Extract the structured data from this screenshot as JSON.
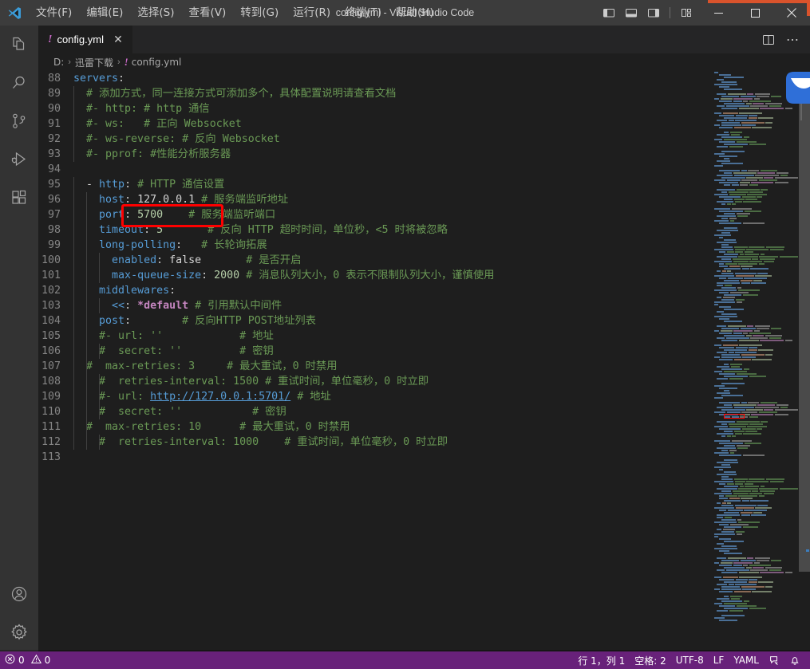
{
  "window": {
    "title": "config.yml - Visual Studio Code",
    "logo_icon": "vscode-logo",
    "minimize_label": "—",
    "maximize_label": "☐",
    "close_label": "✕"
  },
  "menubar": {
    "items": [
      {
        "label": "文件(F)",
        "name": "menu-file"
      },
      {
        "label": "编辑(E)",
        "name": "menu-edit"
      },
      {
        "label": "选择(S)",
        "name": "menu-selection"
      },
      {
        "label": "查看(V)",
        "name": "menu-view"
      },
      {
        "label": "转到(G)",
        "name": "menu-go"
      },
      {
        "label": "运行(R)",
        "name": "menu-run"
      },
      {
        "label": "终端(T)",
        "name": "menu-terminal"
      },
      {
        "label": "帮助(H)",
        "name": "menu-help"
      }
    ]
  },
  "layout_controls": [
    {
      "name": "toggle-primary-sidebar-icon"
    },
    {
      "name": "toggle-panel-icon"
    },
    {
      "name": "toggle-secondary-sidebar-icon"
    },
    {
      "name": "customize-layout-icon"
    }
  ],
  "activitybar": {
    "top": [
      {
        "name": "activity-explorer",
        "icon": "files-icon",
        "active": false
      },
      {
        "name": "activity-search",
        "icon": "search-icon",
        "active": false
      },
      {
        "name": "activity-source-control",
        "icon": "source-control-icon",
        "active": false
      },
      {
        "name": "activity-run-debug",
        "icon": "run-and-debug-icon",
        "active": false
      },
      {
        "name": "activity-extensions",
        "icon": "extensions-icon",
        "active": false
      }
    ],
    "bottom": [
      {
        "name": "activity-accounts",
        "icon": "account-icon"
      },
      {
        "name": "activity-settings",
        "icon": "gear-icon"
      }
    ]
  },
  "tabs": [
    {
      "label": "config.yml",
      "icon": "yaml-file-icon",
      "icon_glyph": "!",
      "close_glyph": "✕",
      "active": true
    }
  ],
  "editor_actions": [
    {
      "name": "split-editor-right-icon"
    },
    {
      "name": "more-actions-icon",
      "glyph": "⋯"
    }
  ],
  "breadcrumb": {
    "items": [
      {
        "label": "D:",
        "name": "breadcrumb-drive"
      },
      {
        "label": "迅雷下载",
        "name": "breadcrumb-folder"
      },
      {
        "label": "config.yml",
        "name": "breadcrumb-file",
        "icon_glyph": "!"
      }
    ],
    "separator": "›"
  },
  "annotation": {
    "name": "red-highlight-box",
    "color": "#ff0000",
    "targets": "port: 5700"
  },
  "editor": {
    "first_line": 88,
    "lines": [
      {
        "n": 88,
        "indent": 0,
        "guides": 0,
        "tokens": [
          {
            "t": "key",
            "v": "servers"
          },
          {
            "t": "punc",
            "v": ":"
          }
        ]
      },
      {
        "n": 89,
        "indent": 2,
        "guides": 1,
        "tokens": [
          {
            "t": "cmt",
            "v": "# 添加方式，同一连接方式可添加多个，具体配置说明请查看文档"
          }
        ]
      },
      {
        "n": 90,
        "indent": 2,
        "guides": 1,
        "tokens": [
          {
            "t": "cmt",
            "v": "#- http: # http 通信"
          }
        ]
      },
      {
        "n": 91,
        "indent": 2,
        "guides": 1,
        "tokens": [
          {
            "t": "cmt",
            "v": "#- ws:   # 正向 Websocket"
          }
        ]
      },
      {
        "n": 92,
        "indent": 2,
        "guides": 1,
        "tokens": [
          {
            "t": "cmt",
            "v": "#- ws-reverse: # 反向 Websocket"
          }
        ]
      },
      {
        "n": 93,
        "indent": 2,
        "guides": 1,
        "tokens": [
          {
            "t": "cmt",
            "v": "#- pprof: #性能分析服务器"
          }
        ]
      },
      {
        "n": 94,
        "indent": 0,
        "guides": 0,
        "tokens": []
      },
      {
        "n": 95,
        "indent": 2,
        "guides": 1,
        "tokens": [
          {
            "t": "plain",
            "v": "- "
          },
          {
            "t": "key",
            "v": "http"
          },
          {
            "t": "punc",
            "v": ": "
          },
          {
            "t": "cmt",
            "v": "# HTTP 通信设置"
          }
        ]
      },
      {
        "n": 96,
        "indent": 4,
        "guides": 2,
        "tokens": [
          {
            "t": "key",
            "v": "host"
          },
          {
            "t": "punc",
            "v": ": "
          },
          {
            "t": "plain",
            "v": "127.0.0.1 "
          },
          {
            "t": "cmt",
            "v": "# 服务端监听地址"
          }
        ]
      },
      {
        "n": 97,
        "indent": 4,
        "guides": 2,
        "tokens": [
          {
            "t": "key",
            "v": "port"
          },
          {
            "t": "punc",
            "v": ": "
          },
          {
            "t": "num",
            "v": "5700"
          },
          {
            "t": "plain",
            "v": "    "
          },
          {
            "t": "cmt",
            "v": "# 服务端监听端口"
          }
        ]
      },
      {
        "n": 98,
        "indent": 4,
        "guides": 2,
        "tokens": [
          {
            "t": "key",
            "v": "timeout"
          },
          {
            "t": "punc",
            "v": ": "
          },
          {
            "t": "num",
            "v": "5"
          },
          {
            "t": "plain",
            "v": "       "
          },
          {
            "t": "cmt",
            "v": "# 反向 HTTP 超时时间，单位秒，<5 时将被忽略"
          }
        ]
      },
      {
        "n": 99,
        "indent": 4,
        "guides": 2,
        "tokens": [
          {
            "t": "key",
            "v": "long-polling"
          },
          {
            "t": "punc",
            "v": ":"
          },
          {
            "t": "plain",
            "v": "   "
          },
          {
            "t": "cmt",
            "v": "# 长轮询拓展"
          }
        ]
      },
      {
        "n": 100,
        "indent": 6,
        "guides": 3,
        "tokens": [
          {
            "t": "key",
            "v": "enabled"
          },
          {
            "t": "punc",
            "v": ": "
          },
          {
            "t": "plain",
            "v": "false"
          },
          {
            "t": "plain",
            "v": "       "
          },
          {
            "t": "cmt",
            "v": "# 是否开启"
          }
        ]
      },
      {
        "n": 101,
        "indent": 6,
        "guides": 3,
        "tokens": [
          {
            "t": "key",
            "v": "max-queue-size"
          },
          {
            "t": "punc",
            "v": ": "
          },
          {
            "t": "num",
            "v": "2000"
          },
          {
            "t": "plain",
            "v": " "
          },
          {
            "t": "cmt",
            "v": "# 消息队列大小，0 表示不限制队列大小，谨慎使用"
          }
        ]
      },
      {
        "n": 102,
        "indent": 4,
        "guides": 2,
        "tokens": [
          {
            "t": "key",
            "v": "middlewares"
          },
          {
            "t": "punc",
            "v": ":"
          }
        ]
      },
      {
        "n": 103,
        "indent": 6,
        "guides": 3,
        "tokens": [
          {
            "t": "key",
            "v": "<<"
          },
          {
            "t": "punc",
            "v": ": "
          },
          {
            "t": "anchor",
            "v": "*default"
          },
          {
            "t": "plain",
            "v": " "
          },
          {
            "t": "cmt",
            "v": "# 引用默认中间件"
          }
        ]
      },
      {
        "n": 104,
        "indent": 4,
        "guides": 2,
        "tokens": [
          {
            "t": "key",
            "v": "post"
          },
          {
            "t": "punc",
            "v": ":"
          },
          {
            "t": "plain",
            "v": "        "
          },
          {
            "t": "cmt",
            "v": "# 反向HTTP POST地址列表"
          }
        ]
      },
      {
        "n": 105,
        "indent": 4,
        "guides": 2,
        "tokens": [
          {
            "t": "cmt",
            "v": "#- url: ''            # 地址"
          }
        ]
      },
      {
        "n": 106,
        "indent": 4,
        "guides": 3,
        "tokens": [
          {
            "t": "cmt",
            "v": "#  secret: ''         # 密钥"
          }
        ]
      },
      {
        "n": 107,
        "indent": 2,
        "guides": 2,
        "tokens": [
          {
            "t": "cmt",
            "v": "#  max-retries: 3     # 最大重试，0 时禁用"
          }
        ]
      },
      {
        "n": 108,
        "indent": 4,
        "guides": 3,
        "tokens": [
          {
            "t": "cmt",
            "v": "#  retries-interval: 1500 # 重试时间，单位毫秒，0 时立即"
          }
        ]
      },
      {
        "n": 109,
        "indent": 4,
        "guides": 3,
        "tokens": [
          {
            "t": "cmt",
            "v": "#- url: "
          },
          {
            "t": "link",
            "v": "http://127.0.0.1:5701/"
          },
          {
            "t": "cmt",
            "v": " # 地址"
          }
        ]
      },
      {
        "n": 110,
        "indent": 4,
        "guides": 3,
        "tokens": [
          {
            "t": "cmt",
            "v": "#  secret: ''           # 密钥"
          }
        ]
      },
      {
        "n": 111,
        "indent": 2,
        "guides": 2,
        "tokens": [
          {
            "t": "cmt",
            "v": "#  max-retries: 10      # 最大重试，0 时禁用"
          }
        ]
      },
      {
        "n": 112,
        "indent": 4,
        "guides": 3,
        "tokens": [
          {
            "t": "cmt",
            "v": "#  retries-interval: 1000    # 重试时间，单位毫秒，0 时立即"
          }
        ]
      },
      {
        "n": 113,
        "indent": 0,
        "guides": 0,
        "tokens": []
      }
    ]
  },
  "statusbar": {
    "background": "#68217a",
    "left": [
      {
        "name": "status-errors",
        "icon": "error-icon",
        "label": "0"
      },
      {
        "name": "status-warnings",
        "icon": "warning-icon",
        "label": "0"
      }
    ],
    "right": [
      {
        "name": "status-cursor-position",
        "label": "行 1，列 1"
      },
      {
        "name": "status-indentation",
        "label": "空格: 2"
      },
      {
        "name": "status-encoding",
        "label": "UTF-8"
      },
      {
        "name": "status-eol",
        "label": "LF"
      },
      {
        "name": "status-language-mode",
        "label": "YAML"
      },
      {
        "name": "status-feedback-icon",
        "label": ""
      },
      {
        "name": "status-notifications-icon",
        "label": ""
      }
    ]
  },
  "colors": {
    "titlebar": "#3c3c3c",
    "activitybar": "#333333",
    "editor_bg": "#1e1e1e",
    "tab_bg": "#252526",
    "statusbar": "#68217a",
    "comment": "#6a9955",
    "key": "#569cd6",
    "number": "#b5cea8",
    "anchor": "#c586c0",
    "annotation": "#ff0000"
  }
}
